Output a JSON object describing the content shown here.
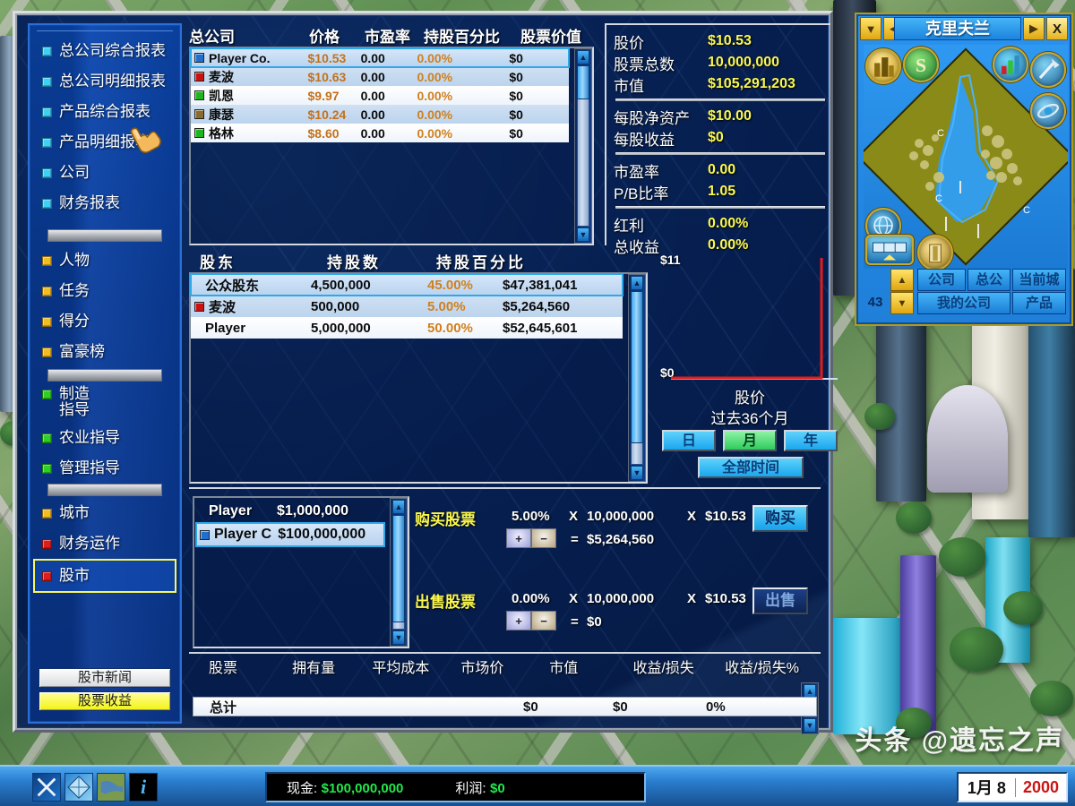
{
  "colors": {
    "panel_blue": "#0a3790",
    "accent_cyan": "#3fd0f5",
    "value_yellow": "#fbf84c",
    "money_orange": "#c4711a",
    "selected_outline": "#f7f75e",
    "cash_green": "#22e84a",
    "year_red": "#cc1414",
    "chart_line": "#e21b1b"
  },
  "sidebar": {
    "groups": [
      {
        "items": [
          {
            "label": "总公司综合报表",
            "bullet": "cyan",
            "icon": "square-bullet-icon"
          },
          {
            "label": "总公司明细报表",
            "bullet": "cyan",
            "icon": "square-bullet-icon"
          },
          {
            "label": "产品综合报表",
            "bullet": "cyan",
            "icon": "square-bullet-icon"
          },
          {
            "label": "产品明细报表",
            "bullet": "cyan",
            "icon": "square-bullet-icon"
          },
          {
            "label": "公司",
            "bullet": "cyan",
            "icon": "square-bullet-icon"
          },
          {
            "label": "财务报表",
            "bullet": "cyan",
            "icon": "square-bullet-icon"
          }
        ]
      },
      {
        "items": [
          {
            "label": "人物",
            "bullet": "amber",
            "icon": "square-bullet-icon"
          },
          {
            "label": "任务",
            "bullet": "amber",
            "icon": "square-bullet-icon"
          },
          {
            "label": "得分",
            "bullet": "amber",
            "icon": "square-bullet-icon"
          },
          {
            "label": "富豪榜",
            "bullet": "amber",
            "icon": "square-bullet-icon"
          }
        ]
      },
      {
        "items": [
          {
            "label": "制造\n指导",
            "bullet": "green",
            "icon": "square-bullet-icon"
          },
          {
            "label": "农业指导",
            "bullet": "green",
            "icon": "square-bullet-icon"
          },
          {
            "label": "管理指导",
            "bullet": "green",
            "icon": "square-bullet-icon"
          }
        ]
      },
      {
        "items": [
          {
            "label": "城市",
            "bullet": "amber",
            "icon": "square-bullet-icon"
          },
          {
            "label": "财务运作",
            "bullet": "red",
            "icon": "square-bullet-icon"
          },
          {
            "label": "股市",
            "bullet": "red",
            "icon": "square-bullet-icon",
            "selected": true
          }
        ]
      }
    ],
    "buttons": [
      {
        "label": "股市新闻",
        "style": "white"
      },
      {
        "label": "股票收益",
        "style": "yellow"
      }
    ]
  },
  "corp_table": {
    "headers": [
      "总公司",
      "价格",
      "市盈率",
      "持股百分比",
      "股票价值"
    ],
    "rows": [
      {
        "name": "Player Co.",
        "swatch": "#1f6fd0",
        "price": "$10.53",
        "pe": "0.00",
        "pct": "0.00%",
        "value": "$0",
        "selected": true
      },
      {
        "name": "麦波",
        "swatch": "#cc1010",
        "price": "$10.63",
        "pe": "0.00",
        "pct": "0.00%",
        "value": "$0"
      },
      {
        "name": "凯恩",
        "swatch": "#1fb51f",
        "price": "$9.97",
        "pe": "0.00",
        "pct": "0.00%",
        "value": "$0"
      },
      {
        "name": "康瑟",
        "swatch": "#8a6a30",
        "price": "$10.24",
        "pe": "0.00",
        "pct": "0.00%",
        "value": "$0"
      },
      {
        "name": "格林",
        "swatch": "#1fb51f",
        "price": "$8.60",
        "pe": "0.00",
        "pct": "0.00%",
        "value": "$0"
      }
    ]
  },
  "stats": {
    "groups": [
      [
        {
          "key": "股价",
          "value": "$10.53"
        },
        {
          "key": "股票总数",
          "value": "10,000,000"
        },
        {
          "key": "市值",
          "value": "$105,291,203"
        }
      ],
      [
        {
          "key": "每股净资产",
          "value": "$10.00"
        },
        {
          "key": "每股收益",
          "value": "$0"
        }
      ],
      [
        {
          "key": "市盈率",
          "value": "0.00"
        },
        {
          "key": "P/B比率",
          "value": "1.05"
        }
      ],
      [
        {
          "key": "红利",
          "value": "0.00%"
        },
        {
          "key": "总收益",
          "value": "0.00%"
        }
      ]
    ]
  },
  "shareholders": {
    "headers": [
      "股东",
      "持股数",
      "持股百分比",
      ""
    ],
    "rows": [
      {
        "name": "公众股东",
        "swatch": null,
        "shares": "4,500,000",
        "pct": "45.00%",
        "value": "$47,381,041",
        "selected": true
      },
      {
        "name": "麦波",
        "swatch": "#cc1010",
        "shares": "500,000",
        "pct": "5.00%",
        "value": "$5,264,560"
      },
      {
        "name": "Player",
        "swatch": null,
        "shares": "5,000,000",
        "pct": "50.00%",
        "value": "$52,645,601"
      }
    ]
  },
  "chart_data": {
    "type": "line",
    "title": "股价",
    "subtitle": "过去36个月",
    "ylabel_top": "$11",
    "ylabel_bottom": "$0",
    "ylim": [
      0,
      11
    ],
    "x": [
      0,
      1,
      2,
      3,
      4,
      5,
      6,
      7,
      8,
      9,
      10,
      11,
      12,
      13,
      14,
      15,
      16,
      17,
      18,
      19,
      20,
      21,
      22,
      23,
      24,
      25,
      26,
      27,
      28,
      29,
      30,
      31,
      32,
      33,
      34,
      35
    ],
    "values": [
      0,
      0,
      0,
      0,
      0,
      0,
      0,
      0,
      0,
      0,
      0,
      0,
      0,
      0,
      0,
      0,
      0,
      0,
      0,
      0,
      0,
      0,
      0,
      0,
      0,
      0,
      0,
      0,
      0,
      0,
      0,
      0,
      0,
      0,
      0,
      10.53
    ],
    "grid": false,
    "legend": "none",
    "line_color": "#e21b1b",
    "range_buttons": [
      {
        "label": "日",
        "active": false
      },
      {
        "label": "月",
        "active": true
      },
      {
        "label": "年",
        "active": false
      }
    ],
    "all_time_button": "全部时间"
  },
  "player_list": {
    "rows": [
      {
        "name": "Player",
        "cash": "$1,000,000",
        "selected": false,
        "swatch": null
      },
      {
        "name": "Player C",
        "cash": "$100,000,000",
        "selected": true,
        "swatch": "#1f6fd0"
      }
    ]
  },
  "trade": {
    "buy": {
      "label": "购买股票",
      "pct": "5.00%",
      "x1_sym": "X",
      "shares": "10,000,000",
      "x2_sym": "X",
      "price": "$10.53",
      "eq_sym": "=",
      "total": "$5,264,560",
      "plus": "+",
      "minus": "−",
      "button": "购买",
      "enabled": true
    },
    "sell": {
      "label": "出售股票",
      "pct": "0.00%",
      "x1_sym": "X",
      "shares": "10,000,000",
      "x2_sym": "X",
      "price": "$10.53",
      "eq_sym": "=",
      "total": "$0",
      "plus": "+",
      "minus": "−",
      "button": "出售",
      "enabled": false
    }
  },
  "portfolio": {
    "headers": [
      "股票",
      "拥有量",
      "平均成本",
      "市场价",
      "市值",
      "收益/损失",
      "收益/损失%"
    ],
    "rows": [],
    "total_label": "总计",
    "total_market_value": "$0",
    "total_gain": "$0",
    "total_gain_pct": "0%"
  },
  "minimap": {
    "city_name": "克里夫兰",
    "nav": {
      "down": "▼",
      "prev": "◀",
      "next": "▶",
      "close": "X"
    },
    "icons": [
      {
        "name": "city-view-icon"
      },
      {
        "name": "stock-dollar-icon"
      },
      {
        "name": "chart-report-icon"
      },
      {
        "name": "construction-icon"
      },
      {
        "name": "research-icon"
      },
      {
        "name": "info-globe-icon"
      },
      {
        "name": "transport-icon"
      },
      {
        "name": "warehouse-icon"
      }
    ],
    "tabs": [
      {
        "label": "公司"
      },
      {
        "label": "总公"
      },
      {
        "label": "当前城市"
      },
      {
        "label": "我的公司"
      },
      {
        "label": "产品"
      }
    ],
    "scroll_up": "▲",
    "scroll_down": "▼",
    "counter": "43"
  },
  "statusbar": {
    "icons": [
      {
        "name": "close-x-icon"
      },
      {
        "name": "world-globe-icon"
      },
      {
        "name": "map-icon"
      },
      {
        "name": "info-icon",
        "glyph": "i"
      }
    ],
    "cash_label": "现金:",
    "cash_value": "$100,000,000",
    "profit_label": "利润:",
    "profit_value": "$0",
    "date": "1月 8",
    "year": "2000"
  },
  "watermark": "头条 @遗忘之声"
}
